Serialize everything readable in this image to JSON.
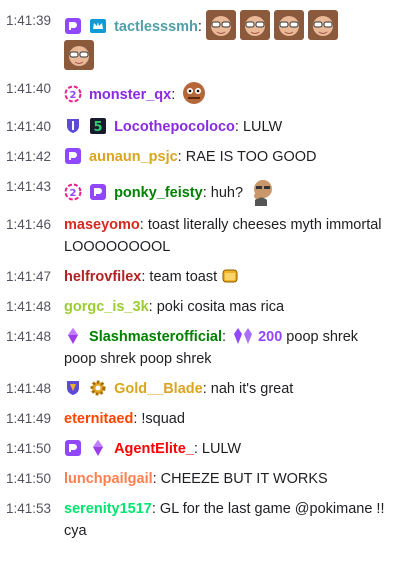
{
  "messages": [
    {
      "time": "1:41:39",
      "user": "tactlesssmh",
      "sep": ":",
      "text": "",
      "color": "#4fa0a8"
    },
    {
      "time": "1:41:40",
      "user": "monster_qx",
      "sep": ":",
      "text": "",
      "color": "#8a2be2"
    },
    {
      "time": "1:41:40",
      "user": "Locothepocoloco",
      "sep": ":",
      "text": " LULW",
      "color": "#8a2be2"
    },
    {
      "time": "1:41:42",
      "user": "aunaun_psjc",
      "sep": ":",
      "text": " RAE IS TOO GOOD",
      "color": "#daa520"
    },
    {
      "time": "1:41:43",
      "user": "ponky_feisty",
      "sep": ":",
      "text": " huh?",
      "color": "#008000"
    },
    {
      "time": "1:41:46",
      "user": "maseyomo",
      "sep": ":",
      "text": " toast literally cheeses myth immortal LOOOOOOOOL",
      "color": "#d42b1e"
    },
    {
      "time": "1:41:47",
      "user": "helfrovfilex",
      "sep": ":",
      "text": " team toast",
      "color": "#b22222"
    },
    {
      "time": "1:41:48",
      "user": "gorgc_is_3k",
      "sep": ":",
      "text": " poki cosita mas rica",
      "color": "#9acd32"
    },
    {
      "time": "1:41:48",
      "user": "Slashmasterofficial",
      "sep": ":",
      "text": " poop shrek poop shrek poop shrek",
      "color": "#008000",
      "bits": "200"
    },
    {
      "time": "1:41:48",
      "user": "Gold__Blade",
      "sep": ":",
      "text": " nah it's great",
      "color": "#daa520"
    },
    {
      "time": "1:41:49",
      "user": "eternitaed",
      "sep": ":",
      "text": " !squad",
      "color": "#ff4500"
    },
    {
      "time": "1:41:50",
      "user": "AgentElite_",
      "sep": ":",
      "text": " LULW",
      "color": "#ff0000"
    },
    {
      "time": "1:41:50",
      "user": "lunchpailgail",
      "sep": ":",
      "text": " CHEEZE BUT IT WORKS",
      "color": "#ff7f50"
    },
    {
      "time": "1:41:53",
      "user": "serenity1517",
      "sep": ":",
      "text": " GL for the last game @pokimane !! cya",
      "color": "#00ff7f"
    }
  ],
  "icons": {
    "prime": "prime-gaming-badge-icon",
    "verified": "crown-badge-icon",
    "gift": "sub-gifter-badge-icon",
    "shield": "subscriber-shield-badge-icon",
    "cheer": "bits-gem-badge-icon",
    "gear": "gear-badge-icon"
  }
}
